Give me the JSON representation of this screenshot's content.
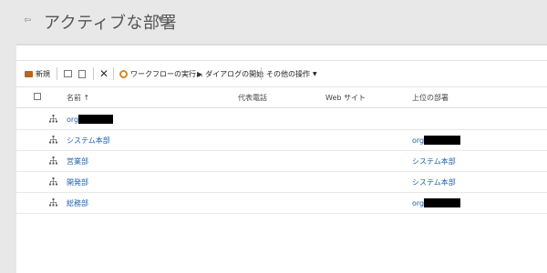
{
  "header": {
    "title": "アクティブな部署"
  },
  "toolbar": {
    "new_label": "新規",
    "workflow_label": "ワークフローの実行...",
    "dialog_label": "ダイアログの開始",
    "more_label": "その他の操作"
  },
  "grid": {
    "columns": {
      "name": "名前 ↑",
      "phone": "代表電話",
      "website": "Web サイト",
      "parent": "上位の部署"
    },
    "rows": [
      {
        "name": "org",
        "name_redacted": true,
        "parent": "",
        "parent_redacted": false
      },
      {
        "name": "システム本部",
        "name_redacted": false,
        "parent": "org",
        "parent_redacted": true
      },
      {
        "name": "営業部",
        "name_redacted": false,
        "parent": "システム本部",
        "parent_redacted": false
      },
      {
        "name": "開発部",
        "name_redacted": false,
        "parent": "システム本部",
        "parent_redacted": false
      },
      {
        "name": "総務部",
        "name_redacted": false,
        "parent": "org",
        "parent_redacted": true
      }
    ]
  },
  "colors": {
    "link": "#1f5fa8",
    "background": "#e8e8e8",
    "panel": "#ffffff"
  }
}
